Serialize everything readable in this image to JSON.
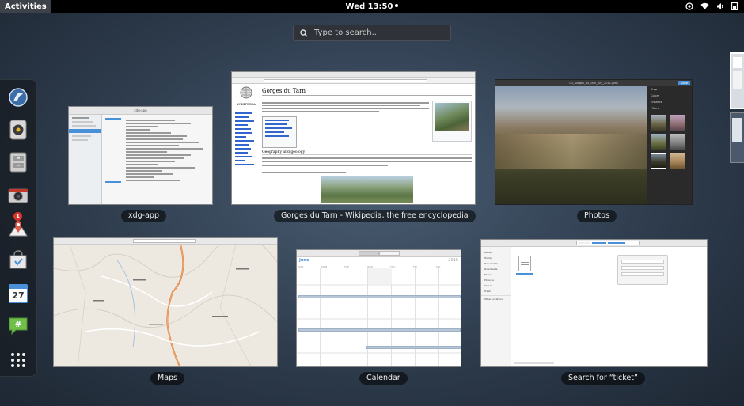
{
  "topbar": {
    "activities_label": "Activities",
    "clock": "Wed 13:50",
    "status_icons": [
      "accessibility-icon",
      "wifi-icon",
      "volume-icon",
      "battery-icon"
    ]
  },
  "search": {
    "placeholder": "Type to search..."
  },
  "dash": {
    "apps": [
      {
        "icon": "web-browser-icon"
      },
      {
        "icon": "music-player-icon"
      },
      {
        "icon": "file-manager-icon"
      },
      {
        "icon": "camera-icon"
      },
      {
        "icon": "maps-icon",
        "badge": "1"
      },
      {
        "icon": "software-store-icon"
      },
      {
        "icon": "calendar-icon",
        "text": "27"
      },
      {
        "icon": "chat-icon"
      },
      {
        "icon": "show-apps-icon"
      }
    ]
  },
  "windows": {
    "xdg": {
      "caption": "xdg-app",
      "header": "xdg-app"
    },
    "wikipedia": {
      "caption": "Gorges du Tarn - Wikipedia, the free encyclopedia",
      "article_title": "Gorges du Tarn",
      "logo_text": "WIKIPEDIA",
      "section_heading": "Geography and geology"
    },
    "photos": {
      "caption": "Photos",
      "header_title": "03_Gorges_du_Tarn_July_2011.jpeg",
      "done_label": "Done",
      "edit_items": [
        "Crop",
        "Colors",
        "Enhance",
        "Filters"
      ]
    },
    "maps": {
      "caption": "Maps"
    },
    "calendar": {
      "caption": "Calendar",
      "month": "June",
      "year": "2016",
      "weekdays": [
        "SUN",
        "MON",
        "TUE",
        "WED",
        "THU",
        "FRI",
        "SAT"
      ]
    },
    "files": {
      "caption": "Search for “ticket”",
      "sidebar_items": [
        "Recent",
        "Home",
        "Documents",
        "Downloads",
        "Music",
        "Pictures",
        "Videos",
        "Trash",
        "Other Locations"
      ]
    }
  },
  "colors": {
    "accent": "#4a90d9",
    "topbar": "#000000",
    "background": "#3a4a5c"
  }
}
